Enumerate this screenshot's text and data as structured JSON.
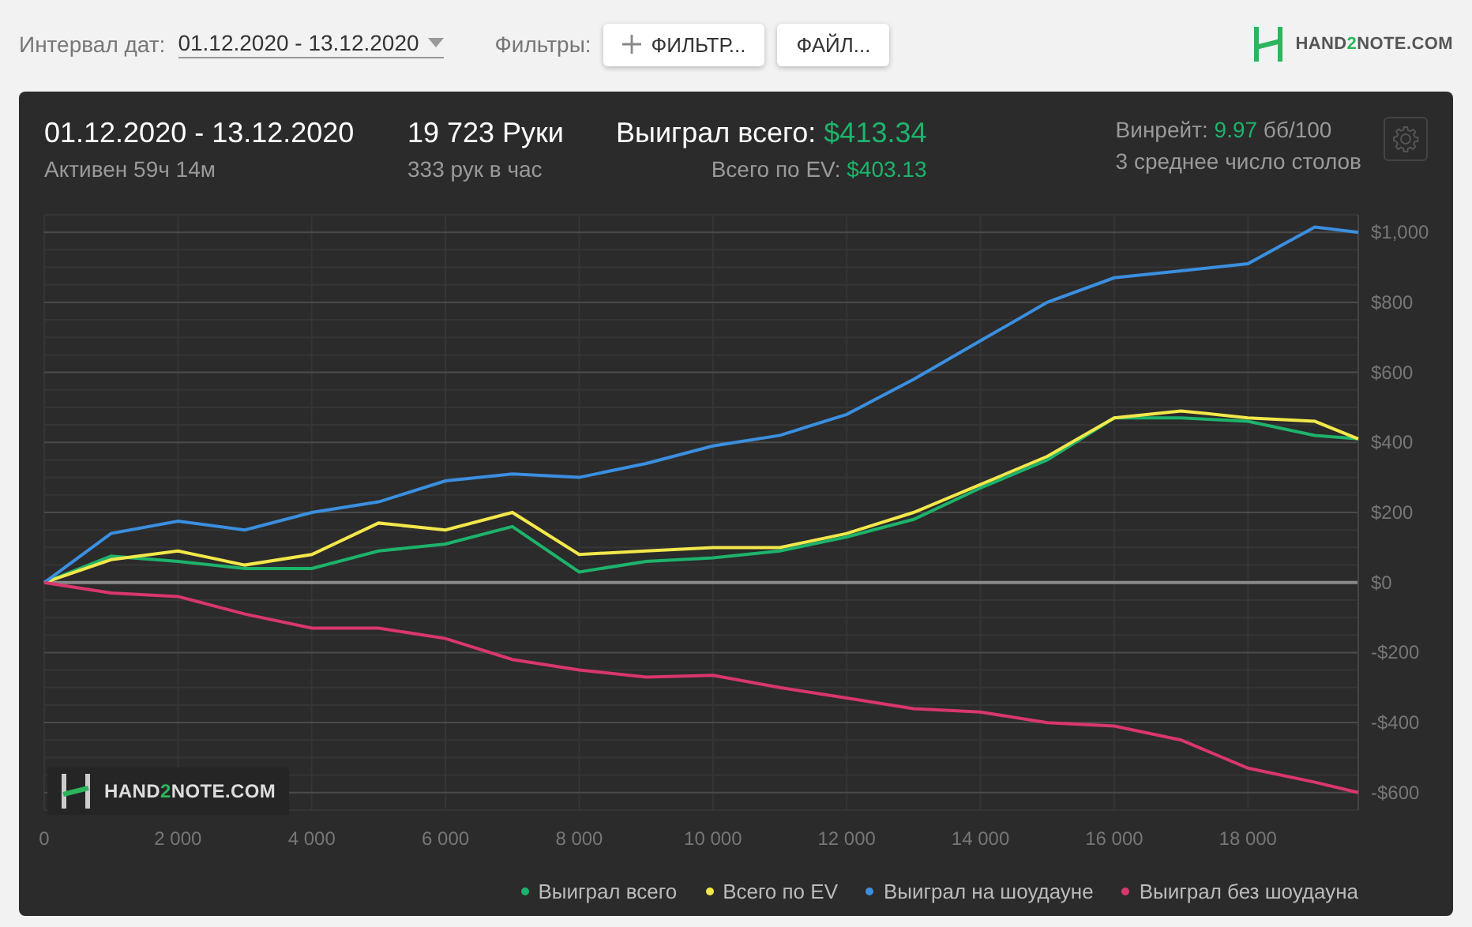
{
  "toolbar": {
    "date_label": "Интервал дат:",
    "date_value": "01.12.2020 - 13.12.2020",
    "filters_label": "Фильтры:",
    "buttons": [
      {
        "kind": "add",
        "label": "ФИЛЬТР..."
      },
      {
        "kind": "plain",
        "label": "ФАЙЛ..."
      }
    ],
    "logo": {
      "prefix": "HAND",
      "accent": "2",
      "suffix": "NOTE.COM"
    }
  },
  "summary": {
    "period": "01.12.2020 - 13.12.2020",
    "active": "Активен 59ч 14м",
    "hands": "19 723 Руки",
    "hands_per_hour": "333 рук в час",
    "won_label": "Выиграл всего:",
    "won_value": "$413.34",
    "ev_label": "Всего по EV:",
    "ev_value": "$403.13",
    "winrate_label": "Винрейт:",
    "winrate_value": "9.97",
    "winrate_unit": "бб/100",
    "tables": "3 среднее число столов"
  },
  "chart": {
    "watermark": {
      "prefix": "HAND",
      "accent": "2",
      "suffix": "NOTE.COM"
    },
    "chart_data": {
      "type": "line",
      "x": [
        0,
        1000,
        2000,
        3000,
        4000,
        5000,
        6000,
        7000,
        8000,
        9000,
        10000,
        11000,
        12000,
        13000,
        14000,
        15000,
        16000,
        17000,
        18000,
        19000,
        19650
      ],
      "series": [
        {
          "name": "Выиграл всего",
          "color": "#1db36b",
          "values": [
            0,
            75,
            60,
            40,
            40,
            90,
            110,
            160,
            30,
            60,
            70,
            90,
            130,
            180,
            270,
            350,
            470,
            470,
            460,
            420,
            410
          ]
        },
        {
          "name": "Всего по EV",
          "color": "#f3e84a",
          "values": [
            0,
            65,
            90,
            50,
            80,
            170,
            150,
            200,
            80,
            90,
            100,
            100,
            140,
            200,
            280,
            360,
            470,
            490,
            470,
            460,
            410
          ]
        },
        {
          "name": "Выиграл на шоудауне",
          "color": "#3b8fe0",
          "values": [
            0,
            140,
            175,
            150,
            200,
            230,
            290,
            310,
            300,
            340,
            390,
            420,
            480,
            580,
            690,
            800,
            870,
            890,
            910,
            1015,
            1000
          ]
        },
        {
          "name": "Выиграл без шоудауна",
          "color": "#d9376c",
          "values": [
            0,
            -30,
            -40,
            -90,
            -130,
            -130,
            -160,
            -220,
            -250,
            -270,
            -265,
            -300,
            -330,
            -360,
            -370,
            -400,
            -410,
            -450,
            -530,
            -570,
            -600
          ]
        }
      ],
      "grid": true,
      "xlim": [
        0,
        19650
      ],
      "ylim": [
        -650,
        1050
      ],
      "xticks": [
        {
          "value": 0,
          "label": "0"
        },
        {
          "value": 2000,
          "label": "2 000"
        },
        {
          "value": 4000,
          "label": "4 000"
        },
        {
          "value": 6000,
          "label": "6 000"
        },
        {
          "value": 8000,
          "label": "8 000"
        },
        {
          "value": 10000,
          "label": "10 000"
        },
        {
          "value": 12000,
          "label": "12 000"
        },
        {
          "value": 14000,
          "label": "14 000"
        },
        {
          "value": 16000,
          "label": "16 000"
        },
        {
          "value": 18000,
          "label": "18 000"
        }
      ],
      "yticks": [
        {
          "value": 1000,
          "label": "$1,000"
        },
        {
          "value": 800,
          "label": "$800"
        },
        {
          "value": 600,
          "label": "$600"
        },
        {
          "value": 400,
          "label": "$400"
        },
        {
          "value": 200,
          "label": "$200"
        },
        {
          "value": 0,
          "label": "$0"
        },
        {
          "value": -200,
          "label": "-$200"
        },
        {
          "value": -400,
          "label": "-$400"
        },
        {
          "value": -600,
          "label": "-$600"
        }
      ]
    }
  }
}
